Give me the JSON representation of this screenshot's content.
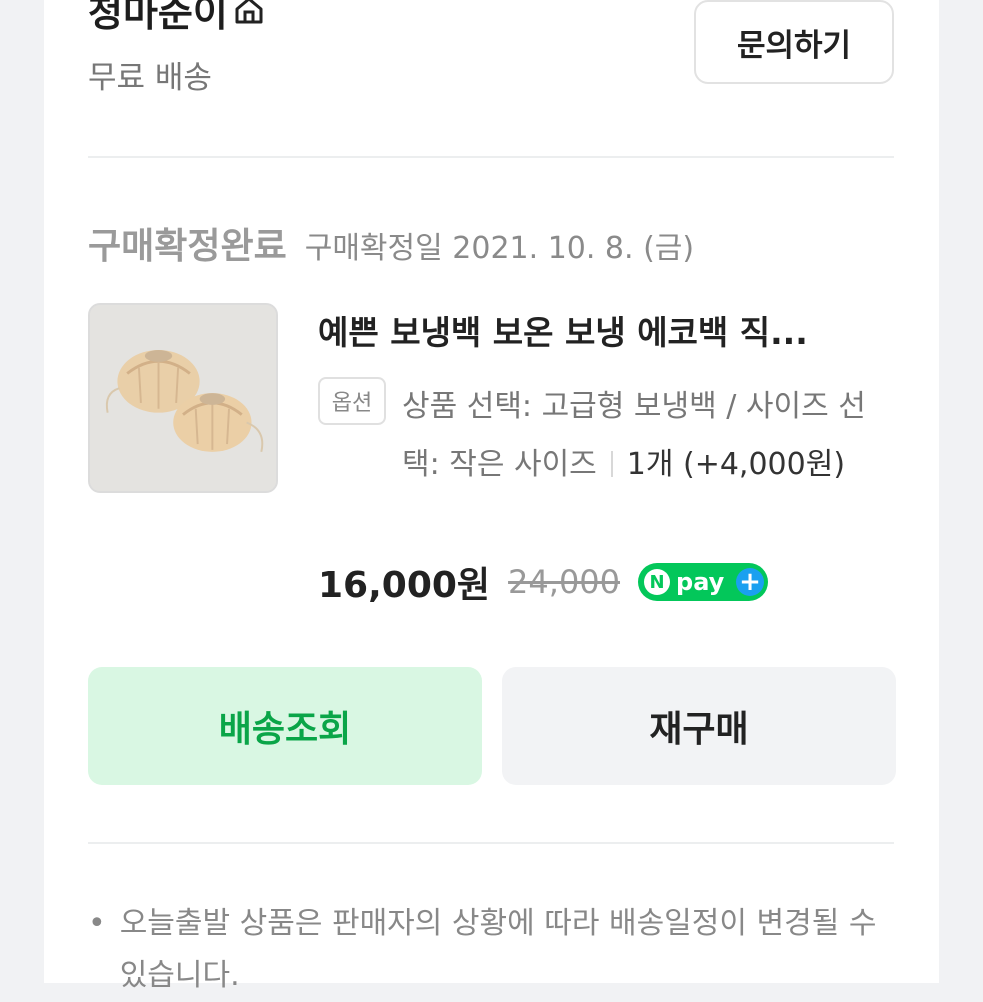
{
  "seller": {
    "name": "청마준이",
    "shipping": "무료 배송",
    "inquiry_label": "문의하기"
  },
  "order": {
    "status": "구매확정완료",
    "status_date": "구매확정일 2021. 10. 8. (금)"
  },
  "product": {
    "title": "예쁜 보냉백 보온 보냉 에코백 직...",
    "option_badge": "옵션",
    "option_text": "상품 선택: 고급형 보냉백 / 사이즈 선택: 작은 사이즈",
    "quantity_text": "1개 (+4,000원)",
    "price": "16,000원",
    "original_price": "24,000",
    "npay_label": "pay"
  },
  "actions": {
    "track_label": "배송조회",
    "rebuy_label": "재구매"
  },
  "notice": {
    "bullet": "•",
    "text": "오늘출발 상품은 판매자의 상황에 따라 배송일정이 변경될 수 있습니다."
  },
  "colors": {
    "accent_green": "#0aa548",
    "track_bg": "#d9f7e3",
    "npay_green": "#03c75a"
  }
}
